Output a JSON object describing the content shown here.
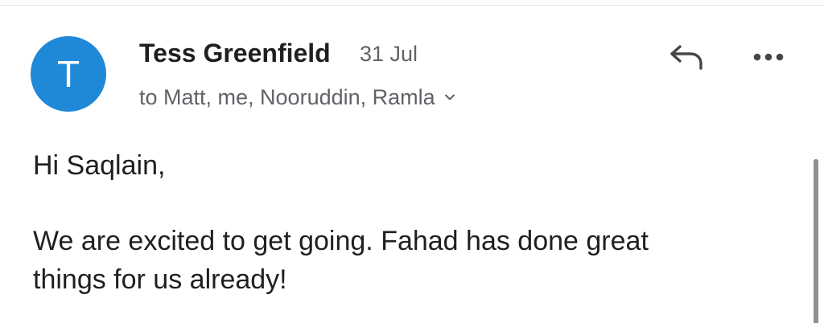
{
  "message": {
    "sender": {
      "initial": "T",
      "name": "Tess Greenfield",
      "avatar_color": "#1f89d8"
    },
    "date": "31 Jul",
    "recipients": "to Matt, me, Nooruddin, Ramla",
    "actions": {
      "reply_icon": "reply-arrow-icon",
      "more_icon": "more-horizontal-icon"
    },
    "body": {
      "greeting": "Hi Saqlain,",
      "paragraph_lines": [
        "We are excited to get going. Fahad has done great",
        "things for us already!"
      ]
    }
  }
}
